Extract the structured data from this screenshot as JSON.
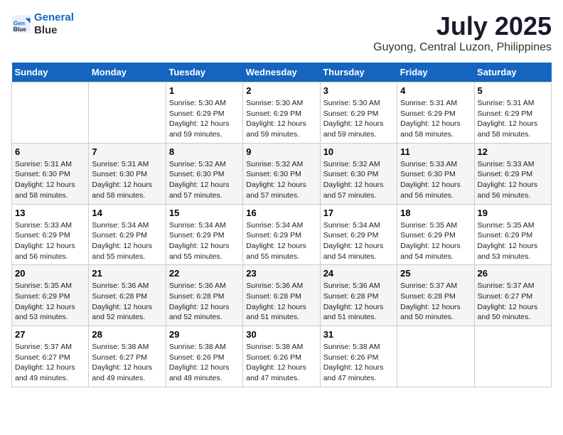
{
  "header": {
    "logo_line1": "General",
    "logo_line2": "Blue",
    "main_title": "July 2025",
    "subtitle": "Guyong, Central Luzon, Philippines"
  },
  "days_of_week": [
    "Sunday",
    "Monday",
    "Tuesday",
    "Wednesday",
    "Thursday",
    "Friday",
    "Saturday"
  ],
  "weeks": [
    [
      {
        "day": "",
        "info": ""
      },
      {
        "day": "",
        "info": ""
      },
      {
        "day": "1",
        "info": "Sunrise: 5:30 AM\nSunset: 6:29 PM\nDaylight: 12 hours and 59 minutes."
      },
      {
        "day": "2",
        "info": "Sunrise: 5:30 AM\nSunset: 6:29 PM\nDaylight: 12 hours and 59 minutes."
      },
      {
        "day": "3",
        "info": "Sunrise: 5:30 AM\nSunset: 6:29 PM\nDaylight: 12 hours and 59 minutes."
      },
      {
        "day": "4",
        "info": "Sunrise: 5:31 AM\nSunset: 6:29 PM\nDaylight: 12 hours and 58 minutes."
      },
      {
        "day": "5",
        "info": "Sunrise: 5:31 AM\nSunset: 6:29 PM\nDaylight: 12 hours and 58 minutes."
      }
    ],
    [
      {
        "day": "6",
        "info": "Sunrise: 5:31 AM\nSunset: 6:30 PM\nDaylight: 12 hours and 58 minutes."
      },
      {
        "day": "7",
        "info": "Sunrise: 5:31 AM\nSunset: 6:30 PM\nDaylight: 12 hours and 58 minutes."
      },
      {
        "day": "8",
        "info": "Sunrise: 5:32 AM\nSunset: 6:30 PM\nDaylight: 12 hours and 57 minutes."
      },
      {
        "day": "9",
        "info": "Sunrise: 5:32 AM\nSunset: 6:30 PM\nDaylight: 12 hours and 57 minutes."
      },
      {
        "day": "10",
        "info": "Sunrise: 5:32 AM\nSunset: 6:30 PM\nDaylight: 12 hours and 57 minutes."
      },
      {
        "day": "11",
        "info": "Sunrise: 5:33 AM\nSunset: 6:30 PM\nDaylight: 12 hours and 56 minutes."
      },
      {
        "day": "12",
        "info": "Sunrise: 5:33 AM\nSunset: 6:29 PM\nDaylight: 12 hours and 56 minutes."
      }
    ],
    [
      {
        "day": "13",
        "info": "Sunrise: 5:33 AM\nSunset: 6:29 PM\nDaylight: 12 hours and 56 minutes."
      },
      {
        "day": "14",
        "info": "Sunrise: 5:34 AM\nSunset: 6:29 PM\nDaylight: 12 hours and 55 minutes."
      },
      {
        "day": "15",
        "info": "Sunrise: 5:34 AM\nSunset: 6:29 PM\nDaylight: 12 hours and 55 minutes."
      },
      {
        "day": "16",
        "info": "Sunrise: 5:34 AM\nSunset: 6:29 PM\nDaylight: 12 hours and 55 minutes."
      },
      {
        "day": "17",
        "info": "Sunrise: 5:34 AM\nSunset: 6:29 PM\nDaylight: 12 hours and 54 minutes."
      },
      {
        "day": "18",
        "info": "Sunrise: 5:35 AM\nSunset: 6:29 PM\nDaylight: 12 hours and 54 minutes."
      },
      {
        "day": "19",
        "info": "Sunrise: 5:35 AM\nSunset: 6:29 PM\nDaylight: 12 hours and 53 minutes."
      }
    ],
    [
      {
        "day": "20",
        "info": "Sunrise: 5:35 AM\nSunset: 6:29 PM\nDaylight: 12 hours and 53 minutes."
      },
      {
        "day": "21",
        "info": "Sunrise: 5:36 AM\nSunset: 6:28 PM\nDaylight: 12 hours and 52 minutes."
      },
      {
        "day": "22",
        "info": "Sunrise: 5:36 AM\nSunset: 6:28 PM\nDaylight: 12 hours and 52 minutes."
      },
      {
        "day": "23",
        "info": "Sunrise: 5:36 AM\nSunset: 6:28 PM\nDaylight: 12 hours and 51 minutes."
      },
      {
        "day": "24",
        "info": "Sunrise: 5:36 AM\nSunset: 6:28 PM\nDaylight: 12 hours and 51 minutes."
      },
      {
        "day": "25",
        "info": "Sunrise: 5:37 AM\nSunset: 6:28 PM\nDaylight: 12 hours and 50 minutes."
      },
      {
        "day": "26",
        "info": "Sunrise: 5:37 AM\nSunset: 6:27 PM\nDaylight: 12 hours and 50 minutes."
      }
    ],
    [
      {
        "day": "27",
        "info": "Sunrise: 5:37 AM\nSunset: 6:27 PM\nDaylight: 12 hours and 49 minutes."
      },
      {
        "day": "28",
        "info": "Sunrise: 5:38 AM\nSunset: 6:27 PM\nDaylight: 12 hours and 49 minutes."
      },
      {
        "day": "29",
        "info": "Sunrise: 5:38 AM\nSunset: 6:26 PM\nDaylight: 12 hours and 48 minutes."
      },
      {
        "day": "30",
        "info": "Sunrise: 5:38 AM\nSunset: 6:26 PM\nDaylight: 12 hours and 47 minutes."
      },
      {
        "day": "31",
        "info": "Sunrise: 5:38 AM\nSunset: 6:26 PM\nDaylight: 12 hours and 47 minutes."
      },
      {
        "day": "",
        "info": ""
      },
      {
        "day": "",
        "info": ""
      }
    ]
  ]
}
